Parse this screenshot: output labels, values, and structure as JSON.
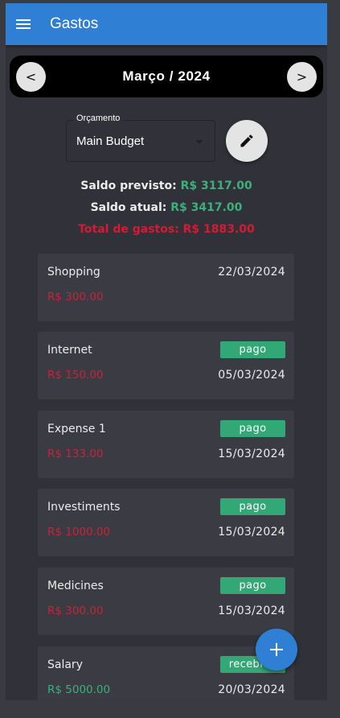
{
  "app": {
    "title": "Gastos"
  },
  "month": {
    "label": "Março / 2024",
    "prev_label": "<",
    "next_label": ">"
  },
  "budget": {
    "legend": "Orçamento",
    "selected": "Main Budget"
  },
  "summary": {
    "saldo_previsto_label": "Saldo previsto:",
    "saldo_previsto_value": "R$ 3117.00",
    "saldo_atual_label": "Saldo atual:",
    "saldo_atual_value": "R$ 3417.00",
    "total_gastos": "Total de gastos: R$ 1883.00"
  },
  "expenses": [
    {
      "name": "Shopping",
      "amount": "R$ 300.00",
      "date": "22/03/2024",
      "status": ""
    },
    {
      "name": "Internet",
      "amount": "R$ 150.00",
      "date": "05/03/2024",
      "status": "pago"
    },
    {
      "name": "Expense 1",
      "amount": "R$ 133.00",
      "date": "15/03/2024",
      "status": "pago"
    },
    {
      "name": "Investiments",
      "amount": "R$ 1000.00",
      "date": "15/03/2024",
      "status": "pago"
    },
    {
      "name": "Medicines",
      "amount": "R$ 300.00",
      "date": "15/03/2024",
      "status": "pago"
    },
    {
      "name": "Salary",
      "amount": "R$ 5000.00",
      "date": "20/03/2024",
      "status": "recebido"
    }
  ],
  "fab": {
    "label": "+"
  },
  "colors": {
    "appbar": "#2f80d4",
    "positive": "#3bb07b",
    "negative": "#d61a33",
    "badge": "#33a877"
  },
  "icons": {
    "menu": "hamburger-icon",
    "edit": "pencil-icon",
    "add": "plus-icon",
    "dropdown": "caret-down-icon"
  }
}
